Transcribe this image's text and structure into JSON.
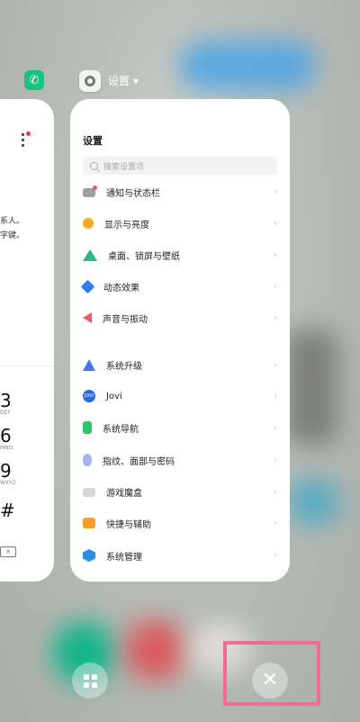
{
  "left_card": {
    "snippet_1": "系人。",
    "snippet_2": "字键。",
    "keys": [
      {
        "digit": "3",
        "letters": "DEF"
      },
      {
        "digit": "6",
        "letters": "MNO"
      },
      {
        "digit": "9",
        "letters": "WXYZ"
      },
      {
        "digit": "#",
        "letters": ""
      }
    ]
  },
  "settings_header": {
    "app_title": "设置 ▾"
  },
  "settings_card": {
    "title": "设置",
    "search_placeholder": "搜索设置项",
    "group1": [
      {
        "label": "通知与状态栏",
        "icon": "notification-icon"
      },
      {
        "label": "显示与亮度",
        "icon": "brightness-icon"
      },
      {
        "label": "桌面、锁屏与壁纸",
        "icon": "wallpaper-icon"
      },
      {
        "label": "动态效果",
        "icon": "motion-effect-icon"
      },
      {
        "label": "声音与振动",
        "icon": "sound-icon"
      }
    ],
    "group2": [
      {
        "label": "系统升级",
        "icon": "system-update-icon"
      },
      {
        "label": "Jovi",
        "icon": "jovi-icon",
        "badge": "JOVI"
      },
      {
        "label": "系统导航",
        "icon": "system-navigation-icon"
      },
      {
        "label": "指纹、面部与密码",
        "icon": "fingerprint-icon"
      },
      {
        "label": "游戏魔盒",
        "icon": "game-box-icon"
      },
      {
        "label": "快捷与辅助",
        "icon": "shortcut-icon"
      },
      {
        "label": "系统管理",
        "icon": "system-management-icon"
      }
    ],
    "chevron": "›"
  },
  "bottom": {
    "close_glyph": "✕"
  },
  "colors": {
    "highlight": "#f06b9a",
    "phone_green": "#19c37d"
  }
}
